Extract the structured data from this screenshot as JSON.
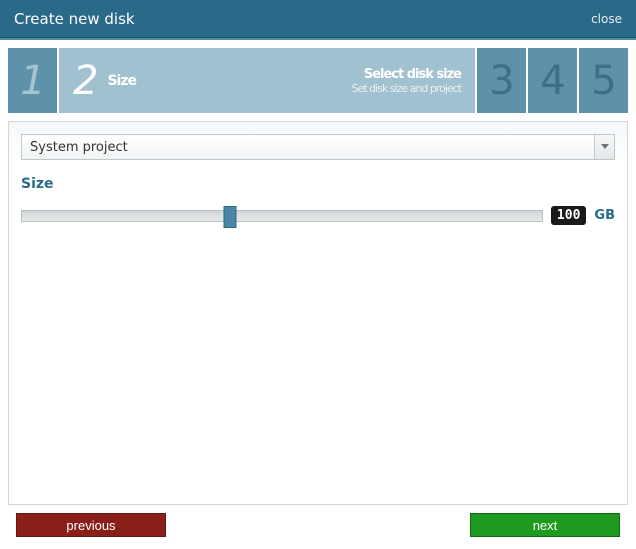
{
  "titlebar": {
    "title": "Create new disk",
    "close": "close"
  },
  "wizard": {
    "step1_num": "1",
    "step2_num": "2",
    "step2_label": "Size",
    "step2_heading": "Select disk size",
    "step2_sub": "Set disk size and project",
    "step3_num": "3",
    "step4_num": "4",
    "step5_num": "5"
  },
  "form": {
    "project_selected": "System project",
    "size_section_label": "Size",
    "size_value": "100",
    "size_unit": "GB"
  },
  "footer": {
    "previous": "previous",
    "next": "next"
  }
}
